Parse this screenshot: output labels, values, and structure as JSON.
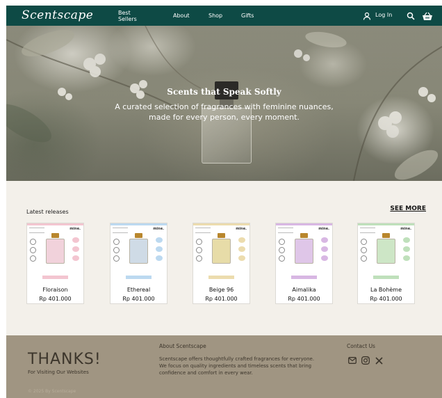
{
  "header": {
    "logo": "Scentscape",
    "nav": [
      "Best Sellers",
      "About",
      "Shop",
      "Gifts"
    ],
    "login_label": "Log In",
    "icons": [
      "user-icon",
      "search-icon",
      "cart-icon"
    ],
    "bg_color": "#0e4a45"
  },
  "hero": {
    "title": "Scents that Speak Softly",
    "subtitle_line1": "A curated selection of fragrances with feminine nuances,",
    "subtitle_line2": "made for every person, every moment."
  },
  "products": {
    "section_title": "Latest releases",
    "see_more_label": "SEE MORE",
    "items": [
      {
        "name": "Floraison",
        "price": "Rp 401.000",
        "accent": "#f3c5d0",
        "bottle": "#f1d2db"
      },
      {
        "name": "Ethereal",
        "price": "Rp 401.000",
        "accent": "#bcd9f0",
        "bottle": "#cfdbe6"
      },
      {
        "name": "Beige 96",
        "price": "Rp 401.000",
        "accent": "#ecdcae",
        "bottle": "#e7dca8"
      },
      {
        "name": "Aimalika",
        "price": "Rp 401.000",
        "accent": "#d8b7e3",
        "bottle": "#dfc6e8"
      },
      {
        "name": "La Bohème",
        "price": "Rp 401.000",
        "accent": "#bfe0bb",
        "bottle": "#cde6c6"
      }
    ],
    "card_brand": "mine."
  },
  "footer": {
    "thanks": "THANKS!",
    "visiting": "For Visiting Our Websites",
    "copyright": "© 2025 By Scentscape",
    "about_title": "About Scentscape",
    "about_text": "Scentscape offers thoughtfully crafted fragrances for everyone. We focus on quality ingredients and timeless scents that bring confidence and comfort in every wear.",
    "contact_title": "Contact Us",
    "social_icons": [
      "mail-icon",
      "instagram-icon",
      "x-icon"
    ],
    "bg_color": "#a09582"
  }
}
